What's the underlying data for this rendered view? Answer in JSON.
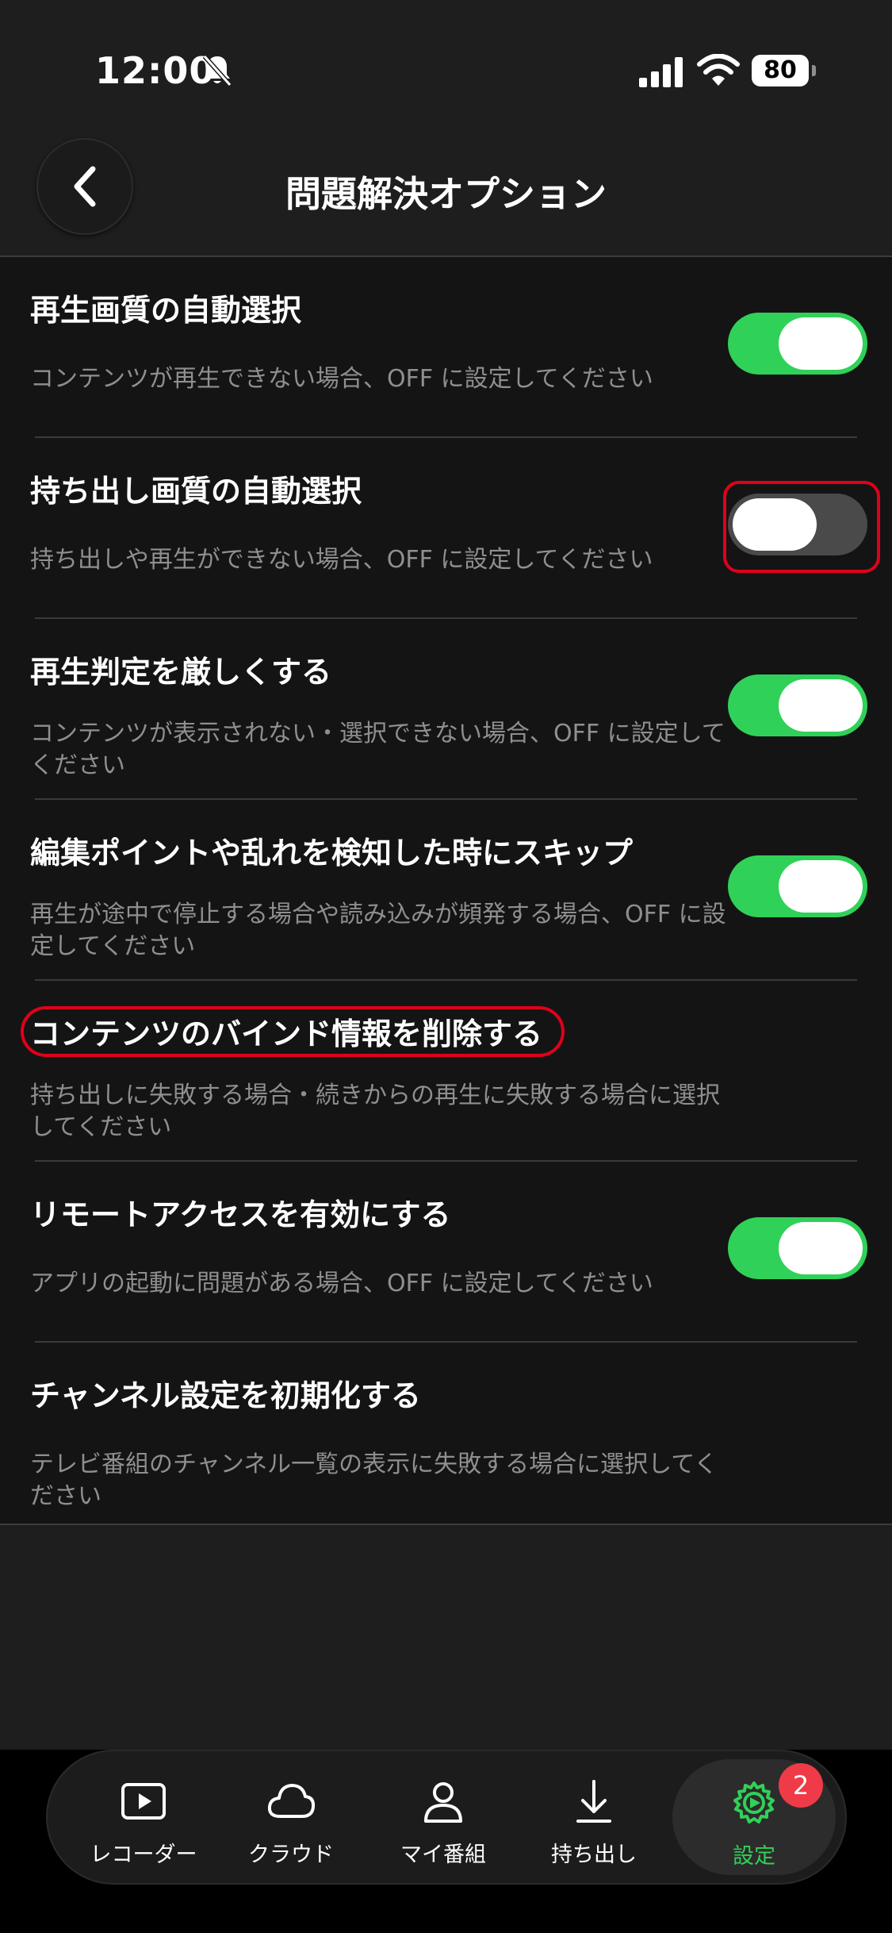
{
  "status_bar": {
    "time": "12:00",
    "battery": "80",
    "icons": [
      "bell-slash-icon",
      "cellular-signal-icon",
      "wifi-icon",
      "battery-icon"
    ]
  },
  "header": {
    "title": "問題解決オプション",
    "back_icon": "chevron-left-icon"
  },
  "settings": [
    {
      "title": "再生画質の自動選択",
      "description": "コンテンツが再生できない場合、OFF に設定してください",
      "toggle": "on"
    },
    {
      "title": "持ち出し画質の自動選択",
      "description": "持ち出しや再生ができない場合、OFF に設定してください",
      "toggle": "off"
    },
    {
      "title": "再生判定を厳しくする",
      "description": "コンテンツが表示されない・選択できない場合、OFF に設定してください",
      "toggle": "on"
    },
    {
      "title": "編集ポイントや乱れを検知した時にスキップ",
      "description": "再生が途中で停止する場合や読み込みが頻発する場合、OFF に設定してください",
      "toggle": "on"
    },
    {
      "title": "コンテンツのバインド情報を削除する",
      "description": "持ち出しに失敗する場合・続きからの再生に失敗する場合に選択してください"
    },
    {
      "title": "リモートアクセスを有効にする",
      "description": "アプリの起動に問題がある場合、OFF に設定してください",
      "toggle": "on"
    },
    {
      "title": "チャンネル設定を初期化する",
      "description": "テレビ番組のチャンネル一覧の表示に失敗する場合に選択してください"
    }
  ],
  "tab_bar": {
    "items": [
      {
        "label": "レコーダー",
        "icon": "play-square-icon"
      },
      {
        "label": "クラウド",
        "icon": "cloud-icon"
      },
      {
        "label": "マイ番組",
        "icon": "person-icon"
      },
      {
        "label": "持ち出し",
        "icon": "download-arrow-icon"
      },
      {
        "label": "設定",
        "icon": "gear-icon",
        "active": true,
        "badge": "2"
      }
    ]
  },
  "colors": {
    "accent": "#30d158",
    "background": "#141414",
    "header": "#1e1e1e",
    "highlight": "#e0001c",
    "badge": "#ef3b47"
  }
}
